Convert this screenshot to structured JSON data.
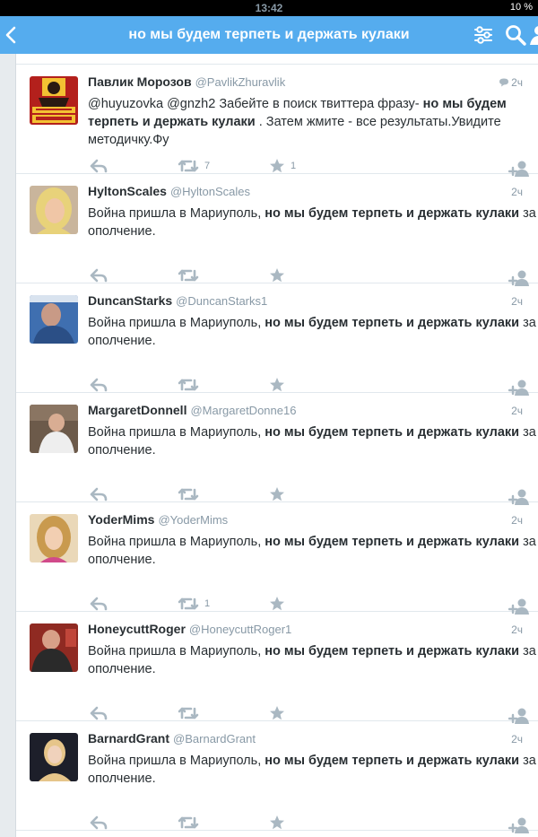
{
  "status": {
    "time": "13:42",
    "battery": "10 %"
  },
  "nav": {
    "title": "но мы будем терпеть и держать кулаки"
  },
  "colors": {
    "accent": "#55acee",
    "muted": "#8899a6",
    "text": "#292f33",
    "icon": "#aab8c2"
  },
  "tweets": [
    {
      "name": "Павлик Морозов",
      "handle": "@PavlikZhuravlik",
      "time": "2ч",
      "avatar": "comrade-pavlik-poster",
      "text_pre": "@huyuzovka @gnzh2 Забейте в поиск твиттера фразу- ",
      "text_bold": "но мы будем терпеть и держать кулаки",
      "text_post": " . Затем жмите - все результаты.Увидите методичку.Фу",
      "retweets": "7",
      "favorites": "1"
    },
    {
      "name": "HyltonScales",
      "handle": "@HyltonScales",
      "time": "2ч",
      "avatar": "blonde-woman-photo",
      "text_pre": "Война пришла в Мариуполь, ",
      "text_bold": "но мы будем терпеть и держать кулаки",
      "text_post": " за ополчение.",
      "retweets": "",
      "favorites": ""
    },
    {
      "name": "DuncanStarks",
      "handle": "@DuncanStarks1",
      "time": "2ч",
      "avatar": "older-man-photo",
      "text_pre": "Война пришла в Мариуполь, ",
      "text_bold": "но мы будем терпеть и держать кулаки",
      "text_post": " за ополчение.",
      "retweets": "",
      "favorites": ""
    },
    {
      "name": "MargaretDonnell",
      "handle": "@MargaretDonne16",
      "time": "2ч",
      "avatar": "man-in-white-shirt-photo",
      "text_pre": "Война пришла в Мариуполь, ",
      "text_bold": "но мы будем терпеть и держать кулаки",
      "text_post": " за ополчение.",
      "retweets": "",
      "favorites": ""
    },
    {
      "name": "YoderMims",
      "handle": "@YoderMims",
      "time": "2ч",
      "avatar": "young-woman-photo",
      "text_pre": "Война пришла в Мариуполь, ",
      "text_bold": "но мы будем терпеть и держать кулаки",
      "text_post": " за ополчение.",
      "retweets": "1",
      "favorites": ""
    },
    {
      "name": "HoneycuttRoger",
      "handle": "@HoneycuttRoger1",
      "time": "2ч",
      "avatar": "man-red-background-photo",
      "text_pre": "Война пришла в Мариуполь, ",
      "text_bold": "но мы будем терпеть и держать кулаки",
      "text_post": " за ополчение.",
      "retweets": "",
      "favorites": ""
    },
    {
      "name": "BarnardGrant",
      "handle": "@BarnardGrant",
      "time": "2ч",
      "avatar": "woman-dark-background-photo",
      "text_pre": "Война пришла в Мариуполь, ",
      "text_bold": "но мы будем терпеть и держать кулаки",
      "text_post": " за ополчение.",
      "retweets": "",
      "favorites": ""
    }
  ]
}
